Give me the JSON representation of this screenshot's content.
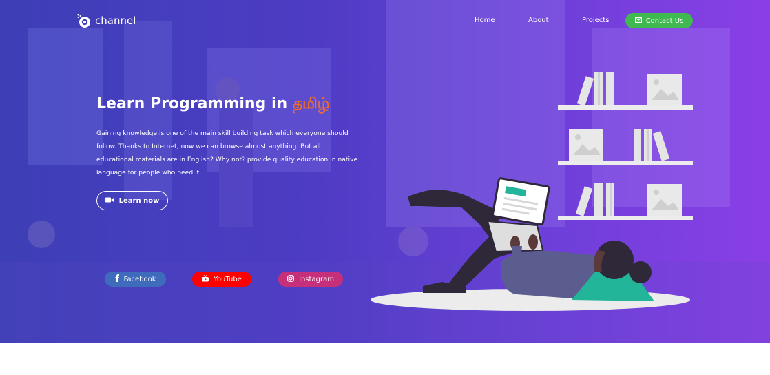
{
  "brand": {
    "name": "channel"
  },
  "nav": {
    "home": "Home",
    "about": "About",
    "projects": "Projects",
    "contact": "Contact Us"
  },
  "hero": {
    "headline": "Learn Programming in ",
    "headline_highlight": "தமிழ்",
    "description": "Gaining knowledge is one of the main skill building task which everyone should follow. Thanks to Internet, now we can browse almost anything. But all educational materials are in English? Why not? provide quality education in native language for people who need it.",
    "cta": "Learn now"
  },
  "social": {
    "facebook": "Facebook",
    "youtube": "YouTube",
    "instagram": "Instagram"
  },
  "icons": {
    "contact": "envelope-icon",
    "cta": "video-camera-icon",
    "facebook": "facebook-icon",
    "youtube": "youtube-icon",
    "instagram": "instagram-icon"
  },
  "colors": {
    "gradient_start": "#3d3fb6",
    "gradient_end": "#8a3fe6",
    "contact_button": "#3fb950",
    "facebook": "#3f6bbd",
    "youtube": "#ff0000",
    "instagram": "#c6307b",
    "tamil_highlight": "#f26b2a"
  }
}
